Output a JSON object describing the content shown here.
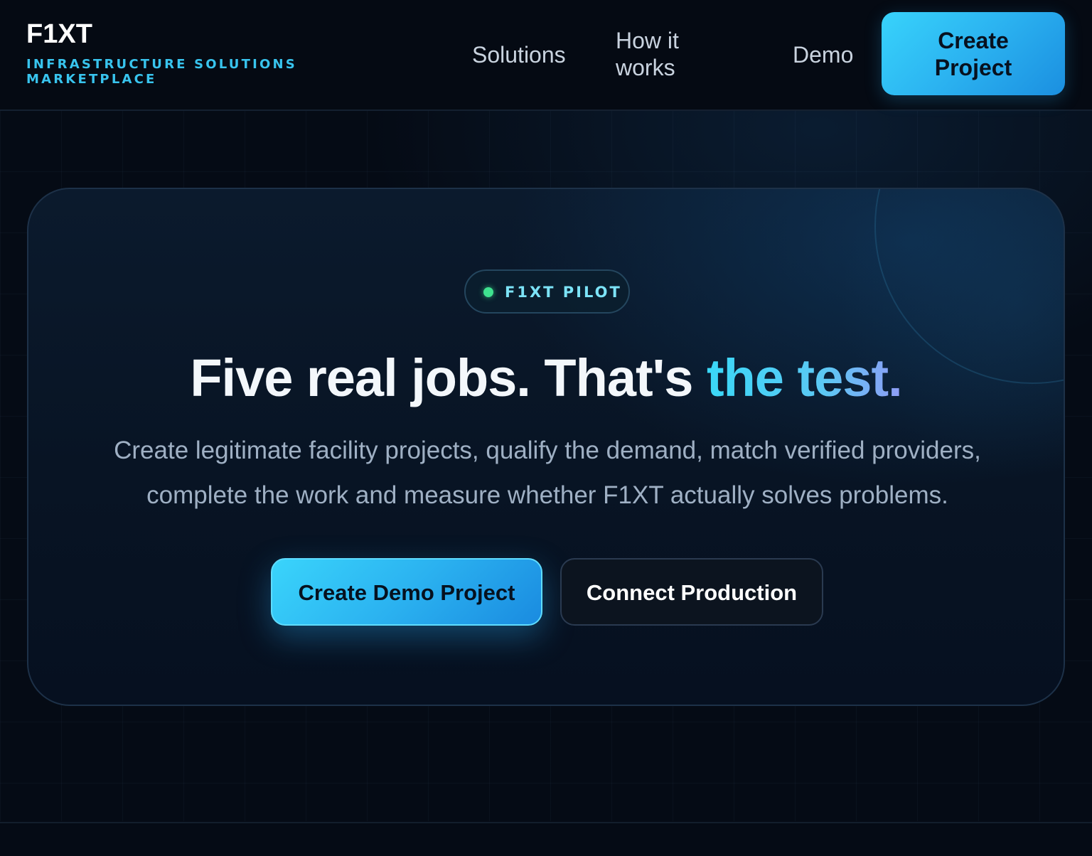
{
  "header": {
    "brand_name": "F1XT",
    "brand_tagline": "INFRASTRUCTURE SOLUTIONS MARKETPLACE",
    "nav": {
      "solutions": "Solutions",
      "how_it_works": "How it works",
      "demo": "Demo"
    },
    "cta_label": "Create Project"
  },
  "hero": {
    "badge_label": "F1XT PILOT",
    "headline_main": "Five real jobs. That's ",
    "headline_accent": "the test.",
    "subtext": "Create legitimate facility projects, qualify the demand, match verified providers, complete the work and measure whether F1XT actually solves problems.",
    "primary_button": "Create Demo Project",
    "secondary_button": "Connect Production"
  },
  "colors": {
    "background": "#050b15",
    "accent": "#38c4ee",
    "badge_dot": "#3fe28f",
    "primary_button": "#2bb2f0"
  },
  "icons": {
    "badge_dot": "status-dot-icon"
  }
}
